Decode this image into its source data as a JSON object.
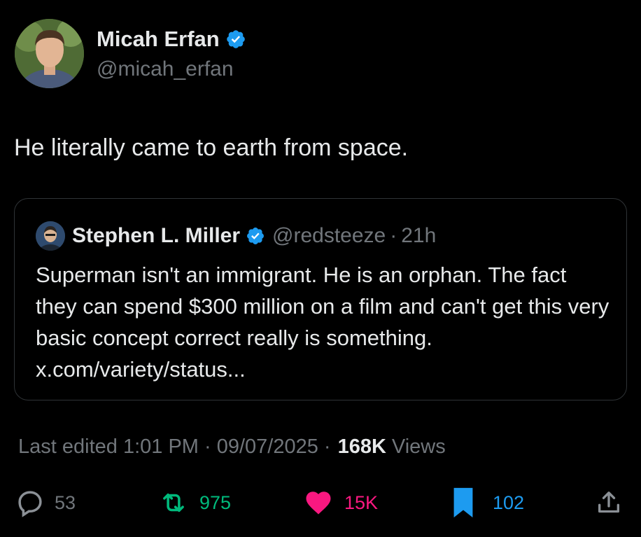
{
  "author": {
    "name": "Micah Erfan",
    "handle": "@micah_erfan",
    "verified_icon": "verified-badge-icon"
  },
  "tweet": {
    "text": "He literally came to earth from space."
  },
  "quoted": {
    "name": "Stephen L. Miller",
    "handle": "@redsteeze",
    "separator": "·",
    "time": "21h",
    "text": "Superman isn't an immigrant. He is an orphan. The fact they can spend $300 million on a film and can't get this very basic concept correct really is something. x.com/variety/status..."
  },
  "meta": {
    "edited": "Last edited 1:01 PM · 09/07/2025 ·",
    "views_count": "168K",
    "views_label": "Views"
  },
  "actions": {
    "replies": "53",
    "reposts": "975",
    "likes": "15K",
    "bookmarks": "102"
  },
  "colors": {
    "background": "#000000",
    "text_primary": "#e7e9ea",
    "text_secondary": "#71767b",
    "verified": "#1d9bf0",
    "repost": "#00ba7c",
    "like": "#f91880",
    "bookmark": "#1d9bf0"
  }
}
